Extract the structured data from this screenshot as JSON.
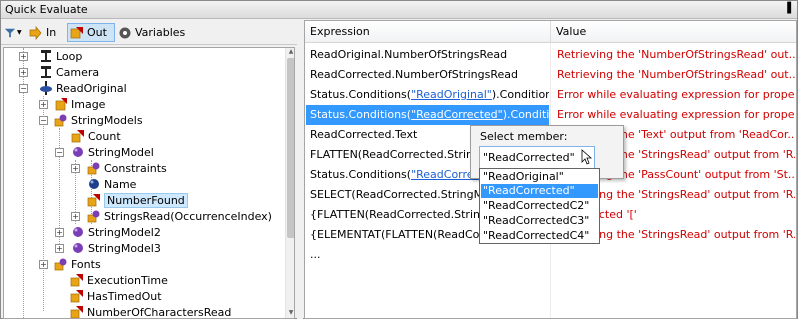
{
  "window": {
    "title": "Quick Evaluate",
    "pin_glyph": "▐"
  },
  "toolbar": {
    "filter_glyph": "▼",
    "in_label": "In",
    "out_label": "Out",
    "variables_label": "Variables"
  },
  "tree": {
    "items": [
      {
        "label": "Loop",
        "expander": "+",
        "icon": "loop-icon"
      },
      {
        "label": "Camera",
        "expander": "+",
        "icon": "camera-icon"
      },
      {
        "label": "ReadOriginal",
        "expander": "−",
        "icon": "tool-icon"
      },
      {
        "label": "Image",
        "expander": "+",
        "icon": "image-icon"
      },
      {
        "label": "StringModels",
        "expander": "−",
        "icon": "collection-icon"
      },
      {
        "label": "Count",
        "expander": "",
        "icon": "value-icon"
      },
      {
        "label": "StringModel",
        "expander": "−",
        "icon": "object-icon"
      },
      {
        "label": "Constraints",
        "expander": "+",
        "icon": "collection-icon"
      },
      {
        "label": "Name",
        "expander": "",
        "icon": "property-icon"
      },
      {
        "label": "NumberFound",
        "expander": "",
        "icon": "value-icon"
      },
      {
        "label": "StringsRead(OccurrenceIndex)",
        "expander": "+",
        "icon": "collection-icon"
      },
      {
        "label": "StringModel2",
        "expander": "+",
        "icon": "object-icon"
      },
      {
        "label": "StringModel3",
        "expander": "+",
        "icon": "object-icon"
      },
      {
        "label": "Fonts",
        "expander": "+",
        "icon": "collection-icon"
      },
      {
        "label": "ExecutionTime",
        "expander": "",
        "icon": "value-icon"
      },
      {
        "label": "HasTimedOut",
        "expander": "",
        "icon": "value-icon"
      },
      {
        "label": "NumberOfCharactersRead",
        "expander": "",
        "icon": "value-icon"
      }
    ]
  },
  "grid": {
    "headers": {
      "expression": "Expression",
      "value": "Value"
    },
    "rows": [
      {
        "expr_pre": "ReadOriginal.NumberOfStringsRead",
        "expr_link": "",
        "expr_post": "",
        "value": "Retrieving the 'NumberOfStringsRead' out..."
      },
      {
        "expr_pre": "ReadCorrected.NumberOfStringsRead",
        "expr_link": "",
        "expr_post": "",
        "value": "Retrieving the 'NumberOfStringsRead' out..."
      },
      {
        "expr_pre": "Status.Conditions(",
        "expr_link": "\"ReadOriginal\"",
        "expr_post": ").Condition",
        "value": "Error while evaluating expression for prope..."
      },
      {
        "expr_pre": "Status.Conditions(",
        "expr_link": "\"ReadCorrected\"",
        "expr_post": ").Conditi...",
        "value": "Error while evaluating expression for prope..."
      },
      {
        "expr_pre": "ReadCorrected.Text",
        "expr_link": "",
        "expr_post": "",
        "value": "Retrieving the 'Text' output from 'ReadCor..."
      },
      {
        "expr_pre": "FLATTEN(ReadCorrected.StringM",
        "expr_link": "",
        "expr_post": "",
        "value": "Retrieving the 'StringsRead' output from 'R..."
      },
      {
        "expr_pre": "Status.Conditions(",
        "expr_link": "\"ReadCorrecte",
        "expr_post": "",
        "value": "Retrieving the 'PassCount' output from 'St..."
      },
      {
        "expr_pre": "SELECT(ReadCorrected.StringMo",
        "expr_link": "",
        "expr_post": "",
        "value": "Retrieving the 'StringsRead' output from 'R..."
      },
      {
        "expr_pre": "{FLATTEN(ReadCorrected.StringM",
        "expr_link": "",
        "expr_post": "",
        "value": "Unexpected '['"
      },
      {
        "expr_pre": "{ELEMENTAT(FLATTEN(ReadCorre",
        "expr_link": "",
        "expr_post": "",
        "value": "Retrieving the 'StringsRead' output from 'R..."
      },
      {
        "expr_pre": "...",
        "expr_link": "",
        "expr_post": "",
        "value": ""
      }
    ]
  },
  "popup": {
    "title": "Select member:",
    "selected": "\"ReadCorrected\"",
    "options": [
      "\"ReadOriginal\"",
      "\"ReadCorrected\"",
      "\"ReadCorrectedC2\"",
      "\"ReadCorrectedC3\"",
      "\"ReadCorrectedC4\""
    ]
  },
  "colors": {
    "error_text": "#d00000",
    "selection": "#3399ff",
    "link": "#1a5fd6"
  }
}
